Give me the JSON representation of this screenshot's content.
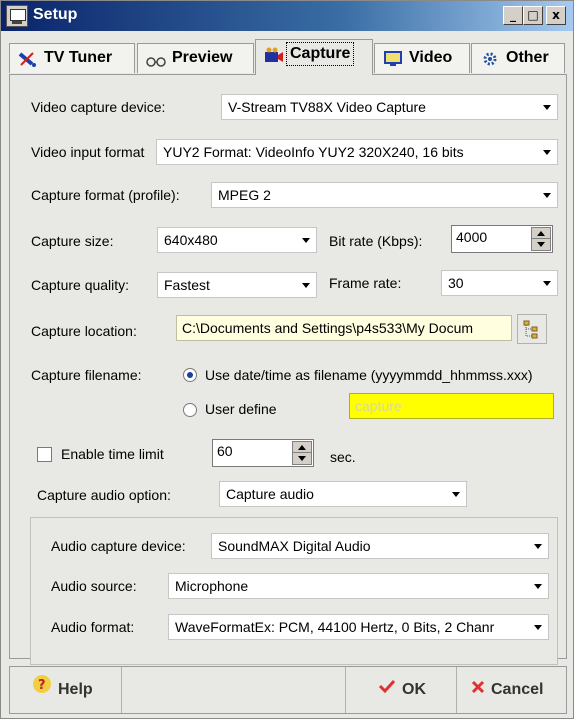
{
  "window": {
    "title": "Setup"
  },
  "title_buttons": {
    "minimize": "_",
    "maximize": "□",
    "close": "x"
  },
  "tabs": [
    {
      "label": "TV Tuner",
      "icon": "satellite-icon"
    },
    {
      "label": "Preview",
      "icon": "glasses-icon"
    },
    {
      "label": "Capture",
      "icon": "camera-icon",
      "active": true
    },
    {
      "label": "Video",
      "icon": "monitor-icon"
    },
    {
      "label": "Other",
      "icon": "gear-icon"
    }
  ],
  "capture": {
    "device_label": "Video capture device:",
    "device_value": "V-Stream TV88X Video Capture",
    "input_format_label": "Video input format",
    "input_format_value": "YUY2 Format: VideoInfo YUY2 320X240, 16 bits",
    "profile_label": "Capture format (profile):",
    "profile_value": "MPEG 2",
    "size_label": "Capture size:",
    "size_value": "640x480",
    "bitrate_label": "Bit rate (Kbps):",
    "bitrate_value": "4000",
    "quality_label": "Capture quality:",
    "quality_value": "Fastest",
    "framerate_label": "Frame rate:",
    "framerate_value": "30",
    "location_label": "Capture location:",
    "location_value": "C:\\Documents and Settings\\p4s533\\My Docum",
    "filename_label": "Capture filename:",
    "filename_option_date": "Use date/time as filename (yyyymmdd_hhmmss.xxx)",
    "filename_option_user": "User define",
    "user_filename_value": "capture",
    "time_limit_label": "Enable time limit",
    "time_limit_value": "60",
    "time_limit_unit": "sec.",
    "audio_option_label": "Capture audio option:",
    "audio_option_value": "Capture audio"
  },
  "audio": {
    "device_label": "Audio capture device:",
    "device_value": "SoundMAX Digital Audio",
    "source_label": "Audio source:",
    "source_value": "Microphone",
    "format_label": "Audio format:",
    "format_value": "WaveFormatEx: PCM, 44100 Hertz, 0 Bits, 2 Chanr"
  },
  "buttons": {
    "help": "Help",
    "ok": "OK",
    "cancel": "Cancel"
  },
  "colors": {
    "user_filename_bg": "#ffff00",
    "user_filename_text": "#d8d8a0",
    "ok_check": "#e03030",
    "cancel_x": "#e03030"
  }
}
